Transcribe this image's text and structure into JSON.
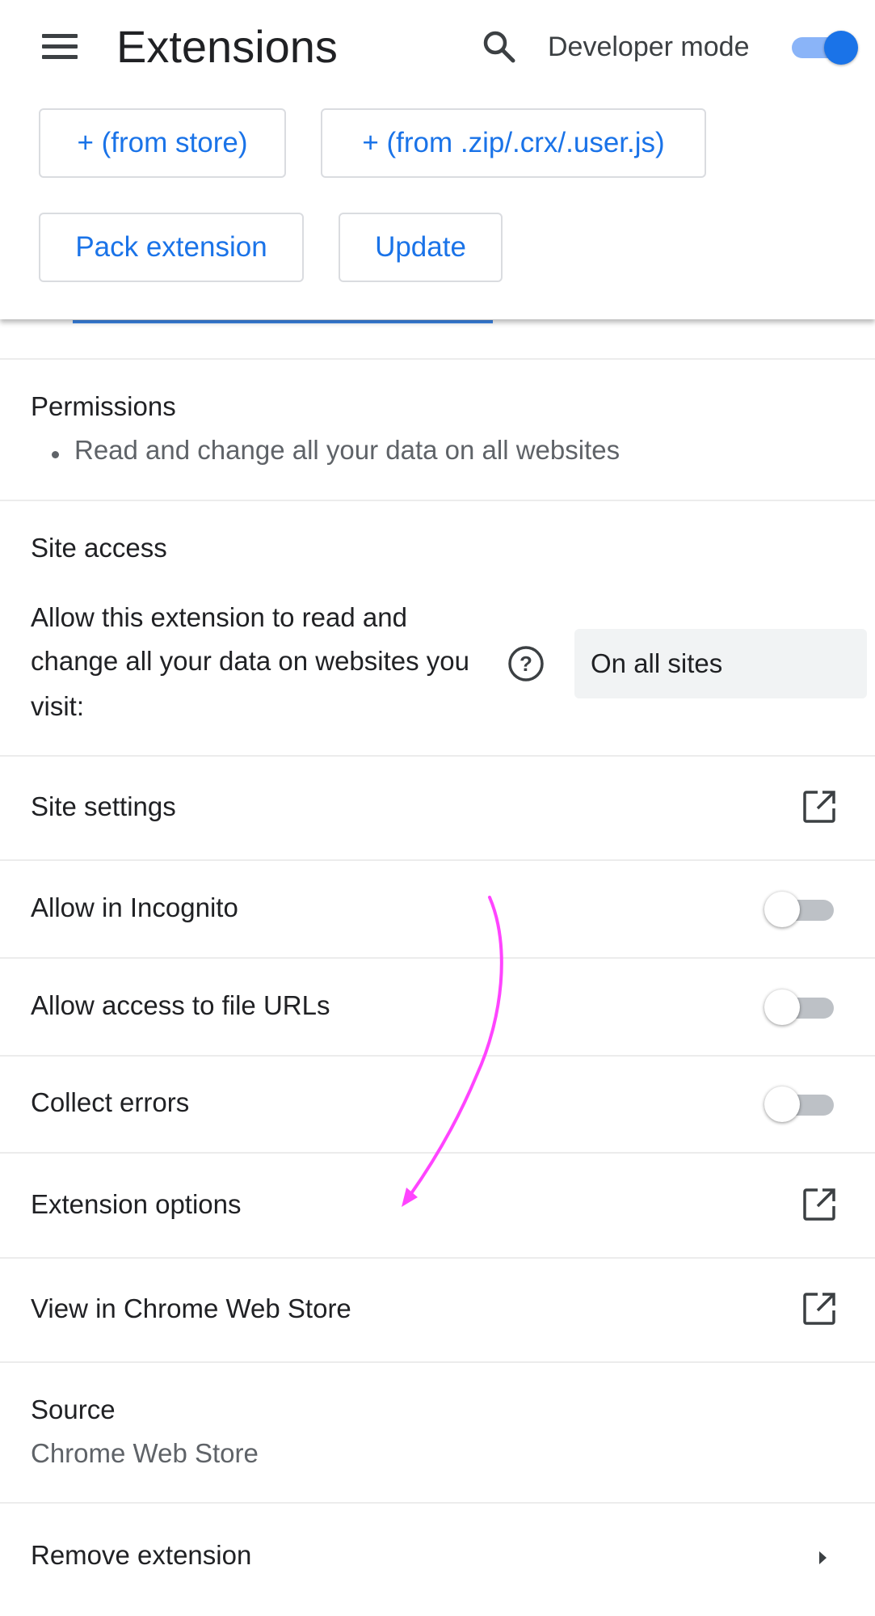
{
  "header": {
    "title": "Extensions",
    "developer_mode_label": "Developer mode",
    "developer_mode_on": true,
    "buttons": {
      "from_store": "+ (from store)",
      "from_file": "+ (from .zip/.crx/.user.js)",
      "pack": "Pack extension",
      "update": "Update"
    }
  },
  "permissions": {
    "label": "Permissions",
    "items": [
      "Read and change all your data on all websites"
    ]
  },
  "site_access": {
    "label": "Site access",
    "description_lines": [
      "Allow this extension to read and",
      "change all your data on websites you",
      "visit:"
    ],
    "selected_option": "On all sites"
  },
  "rows": {
    "site_settings": "Site settings",
    "allow_incognito": "Allow in Incognito",
    "allow_file_urls": "Allow access to file URLs",
    "collect_errors": "Collect errors",
    "extension_options": "Extension options",
    "view_in_store": "View in Chrome Web Store",
    "remove_extension": "Remove extension"
  },
  "toggles": {
    "allow_incognito": false,
    "allow_file_urls": false,
    "collect_errors": false
  },
  "source": {
    "label": "Source",
    "value": "Chrome Web Store"
  },
  "colors": {
    "accent": "#1a73e8",
    "annotation_arrow": "#ff44ff",
    "toggle_off_track": "#bdc1c6"
  },
  "icons": [
    "menu-icon",
    "search-icon",
    "help-icon",
    "open-in-new-icon",
    "chevron-right-icon"
  ]
}
